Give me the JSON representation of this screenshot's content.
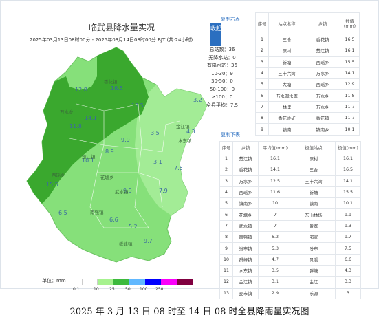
{
  "header": {
    "title": "临武县降水量实况",
    "subtitle": "2025年03月13日08时00分 - 2025年03月14日08时00分 BJT (共:24小时)",
    "collapse_button": "收起"
  },
  "stats": {
    "lines": [
      "总站数：36",
      "无降水站：0",
      "有降水站：36",
      "10-30：9",
      "30-50：0",
      "50-100：0",
      "≥100：0",
      "全县平均：7.5"
    ]
  },
  "legend": {
    "unit": "单位：mm",
    "colors": [
      "#ffffff",
      "#a6f28f",
      "#3dba3d",
      "#61b8ff",
      "#0000fe",
      "#fa00fa",
      "#800040"
    ],
    "labels": [
      "0.1",
      "10",
      "25",
      "50",
      "100",
      "250"
    ]
  },
  "map": {
    "colors": {
      "light": "#86e07a",
      "dark": "#3aa82e",
      "lighter": "#9aeb8e",
      "pale": "#b8f0b0"
    },
    "values": [
      {
        "v": "12.8"
      },
      {
        "v": "16.5"
      },
      {
        "v": "13.5"
      },
      {
        "v": "14.1"
      },
      {
        "v": "11.8"
      },
      {
        "v": "8.9"
      },
      {
        "v": "9.9"
      },
      {
        "v": "10.1"
      },
      {
        "v": "15.5"
      },
      {
        "v": "6.5"
      },
      {
        "v": "9.9"
      },
      {
        "v": "6.6"
      },
      {
        "v": "5.2"
      },
      {
        "v": "9.7"
      },
      {
        "v": "3.5"
      },
      {
        "v": "3.1"
      },
      {
        "v": "7.5"
      },
      {
        "v": "7.9"
      },
      {
        "v": "4.3"
      },
      {
        "v": "3.2"
      }
    ],
    "places": [
      {
        "name": "香花镇"
      },
      {
        "name": "万水乡"
      },
      {
        "name": "楚江镇"
      },
      {
        "name": "西瑶乡"
      },
      {
        "name": "花塘乡"
      },
      {
        "name": "南强镇"
      },
      {
        "name": "武水镇"
      },
      {
        "name": "舜峰镇"
      },
      {
        "name": "金江镇"
      },
      {
        "name": "水东镇"
      }
    ]
  },
  "station_table": {
    "heading": "复制右表",
    "columns": [
      "序号",
      "站点名称",
      "乡镇",
      "数值\n(mm)"
    ],
    "rows": [
      [
        "1",
        "三合",
        "香花镇",
        "16.5"
      ],
      [
        "2",
        "原村",
        "楚江镇",
        "16.1"
      ],
      [
        "3",
        "新塘",
        "西瑶乡",
        "15.5"
      ],
      [
        "4",
        "三十六湾",
        "万水乡",
        "14.1"
      ],
      [
        "5",
        "大塘",
        "西瑶乡",
        "12.9"
      ],
      [
        "6",
        "万水洞水库",
        "万水乡",
        "11.8"
      ],
      [
        "7",
        "林里",
        "万水乡",
        "11.7"
      ],
      [
        "8",
        "香花岭矿",
        "香花镇",
        "11.7"
      ],
      [
        "9",
        "镇南",
        "镇南乡",
        "10.1"
      ]
    ]
  },
  "town_table": {
    "heading": "复制下表",
    "columns": [
      "序号",
      "乡镇",
      "平均值(mm)",
      "极值站点",
      "极值(mm)"
    ],
    "rows": [
      [
        "1",
        "楚江镇",
        "16.1",
        "原村",
        "16.1"
      ],
      [
        "2",
        "香花镇",
        "14.1",
        "三合",
        "16.5"
      ],
      [
        "3",
        "万水乡",
        "12.5",
        "三十六湾",
        "14.1"
      ],
      [
        "4",
        "西瑶乡",
        "11.6",
        "新塘",
        "15.5"
      ],
      [
        "5",
        "镇南乡",
        "10",
        "镇南",
        "10.1"
      ],
      [
        "6",
        "花塘乡",
        "7",
        "东山林场",
        "9.9"
      ],
      [
        "7",
        "武水镇",
        "7",
        "黄寨",
        "9.3"
      ],
      [
        "8",
        "南强镇",
        "6.2",
        "邹家",
        "9.7"
      ],
      [
        "9",
        "汾市镇",
        "5.3",
        "汾市",
        "7.5"
      ],
      [
        "10",
        "舜峰镇",
        "4.7",
        "贝溪",
        "6.6"
      ],
      [
        "11",
        "水东镇",
        "3.5",
        "胖塘",
        "4.3"
      ],
      [
        "12",
        "金江镇",
        "3.1",
        "金江",
        "3.3"
      ],
      [
        "13",
        "麦市镇",
        "2.9",
        "乐源",
        "3"
      ]
    ]
  },
  "caption": "2025 年 3 月 13 日 08 时至 14 日 08 时全县降雨量实况图"
}
